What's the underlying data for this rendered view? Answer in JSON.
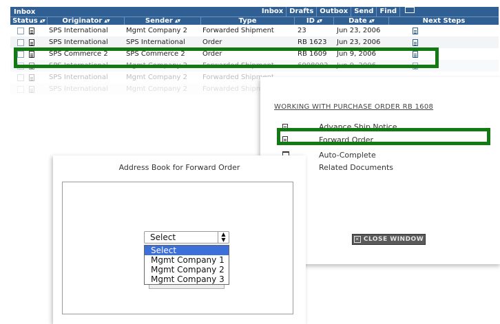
{
  "inbox": {
    "title": "Inbox",
    "nav": [
      "Inbox",
      "Drafts",
      "Outbox",
      "Send",
      "Find"
    ],
    "columns": [
      "Status",
      "Originator",
      "Sender",
      "Type",
      "ID",
      "Date",
      "Next Steps"
    ],
    "rows": [
      {
        "originator": "SPS International",
        "sender": "Mgmt Company 2",
        "type": "Forwarded Shipment",
        "id": "23",
        "date": "Jun 23, 2006"
      },
      {
        "originator": "SPS International",
        "sender": "SPS International",
        "type": "Order",
        "id": "RB 1623",
        "date": "Jun 23, 2006"
      },
      {
        "originator": "SPS Commerce 2",
        "sender": "SPS Commerce 2",
        "type": "Order",
        "id": "RB 1609",
        "date": "Jun 9, 2006"
      },
      {
        "originator": "SPS International",
        "sender": "Mgmt Company 2",
        "type": "Forwarded Shipment",
        "id": "6008002",
        "date": "Jun 9, 2006"
      },
      {
        "originator": "SPS International",
        "sender": "Mgmt Company 2",
        "type": "Forwarded Shipment",
        "id": "",
        "date": ""
      },
      {
        "originator": "SPS International",
        "sender": "Mgmt Company 2",
        "type": "Forwarded Shipment",
        "id": "",
        "date": ""
      }
    ]
  },
  "working": {
    "heading": "WORKING WITH  PURCHASE ORDER  RB 1608",
    "links": [
      "Advance Ship Notice",
      "Forward Order",
      "Auto-Complete",
      "Related Documents"
    ],
    "close_label": "CLOSE WINDOW"
  },
  "address_book": {
    "title": "Address Book for Forward Order",
    "select_value": "Select",
    "options": [
      "Select",
      "Mgmt Company 1",
      "Mgmt Company 2",
      "Mgmt Company 3"
    ]
  },
  "colors": {
    "header_blue": "#2f5f93",
    "highlight_green": "#137a13",
    "option_selected": "#3d6fd9"
  }
}
